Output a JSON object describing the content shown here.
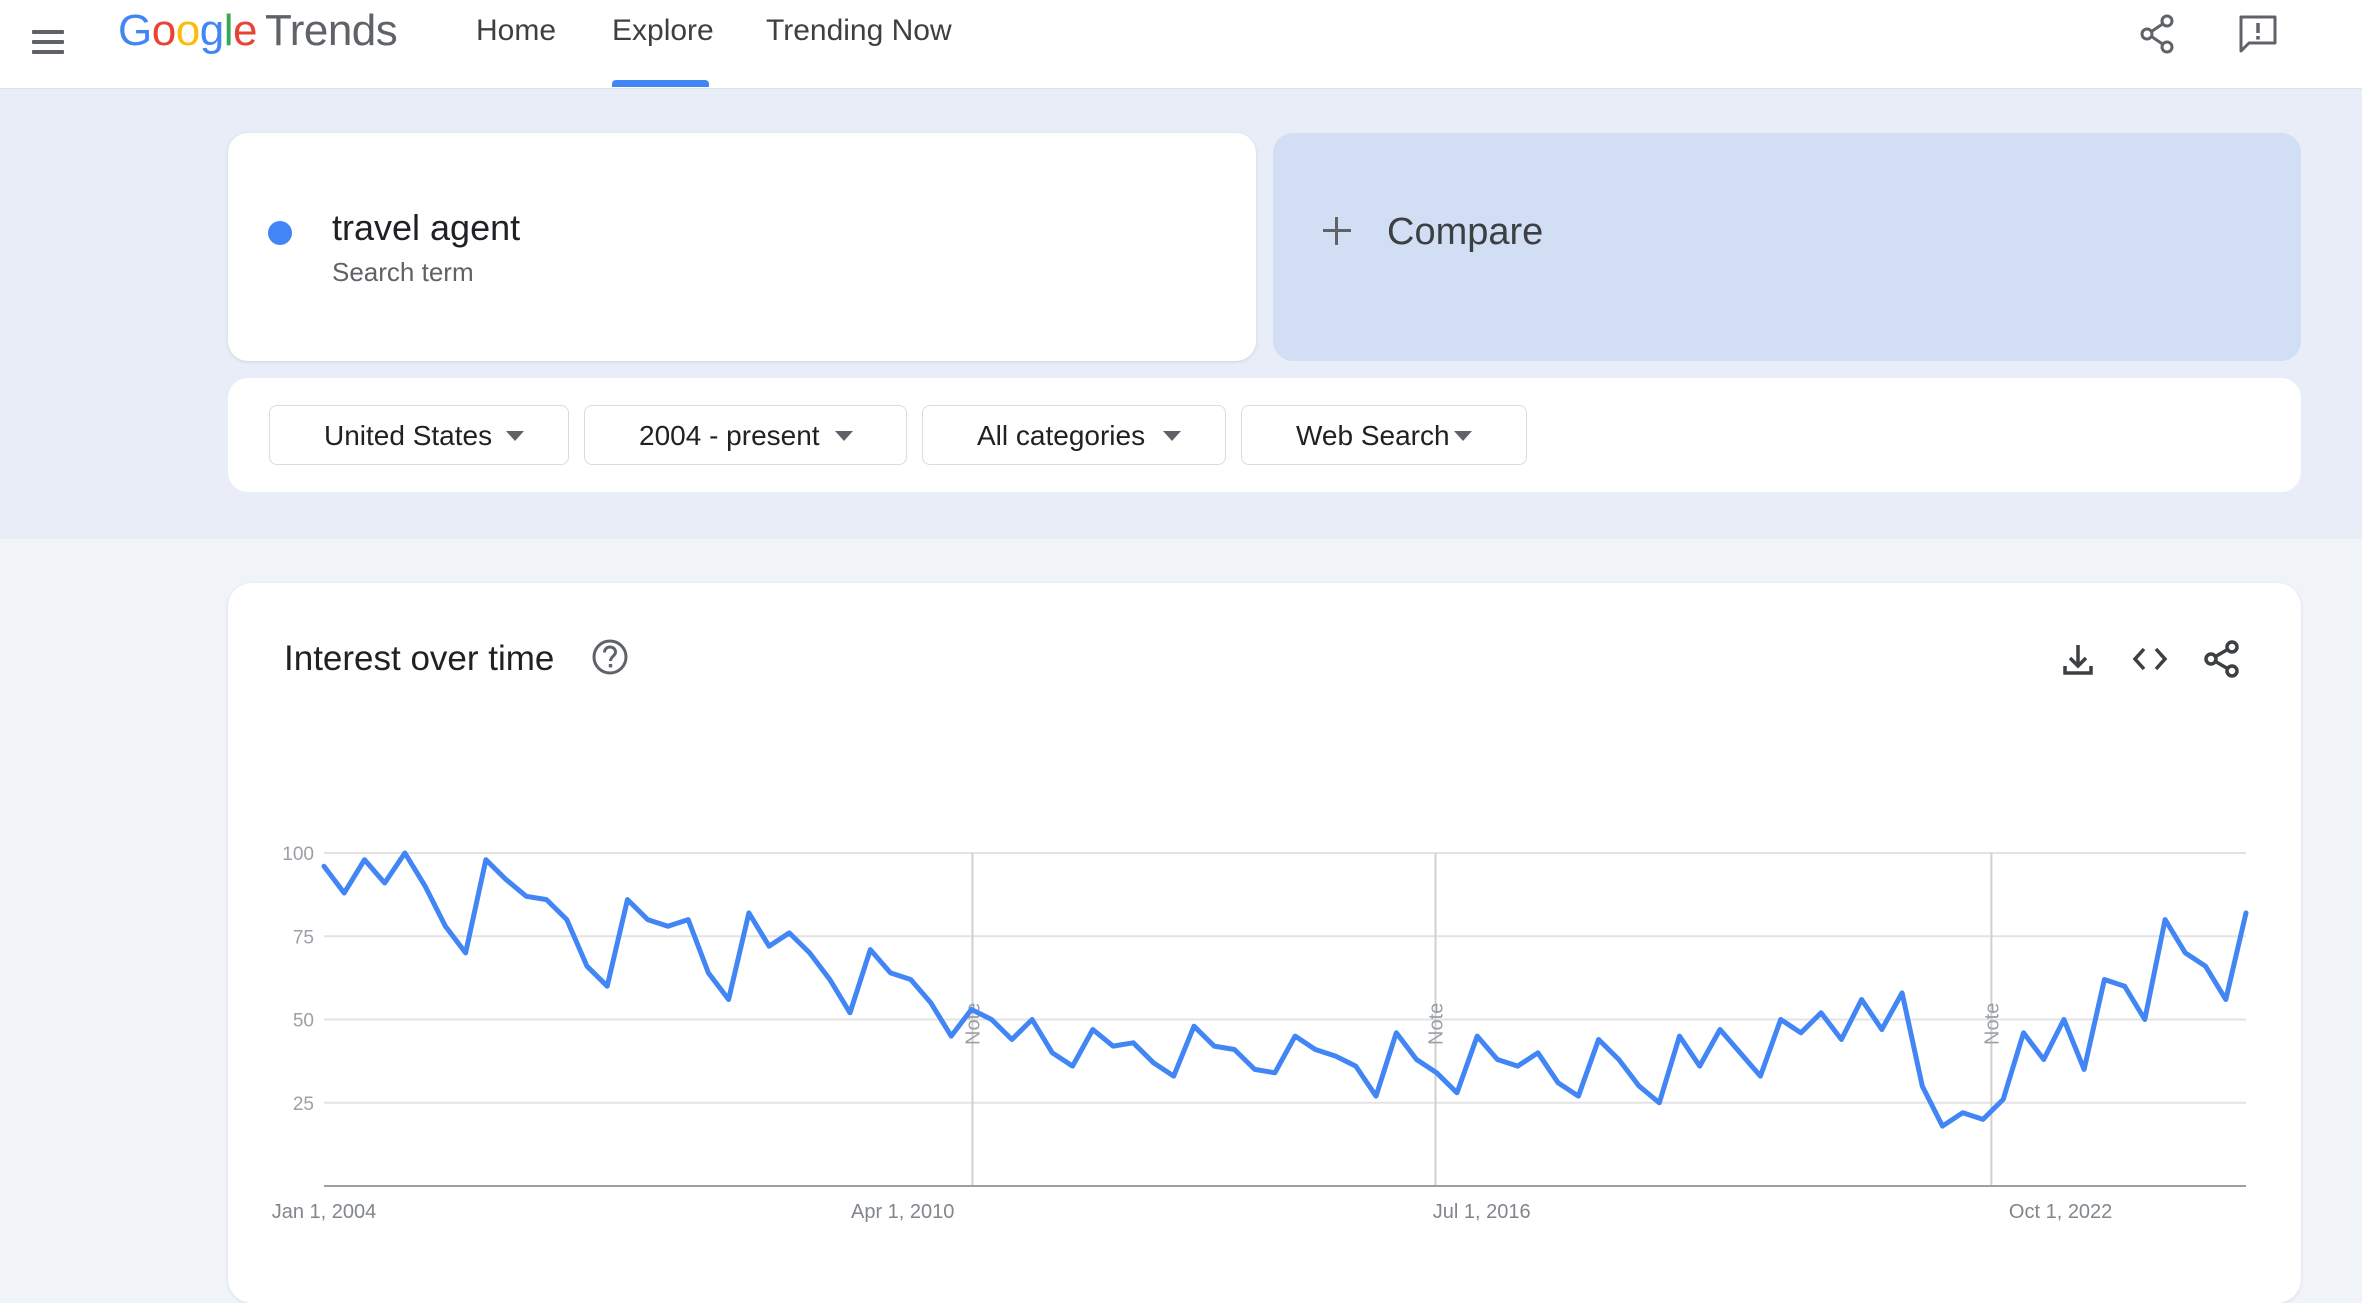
{
  "app": {
    "logo_google": [
      "G",
      "o",
      "o",
      "g",
      "l",
      "e"
    ],
    "logo_trends": "Trends",
    "nav": {
      "home": "Home",
      "explore": "Explore",
      "trending": "Trending Now"
    }
  },
  "search": {
    "term": "travel agent",
    "term_type": "Search term",
    "term_color": "#4285f4",
    "compare_label": "Compare"
  },
  "filters": {
    "region": "United States",
    "time_range": "2004 - present",
    "category": "All categories",
    "property": "Web Search"
  },
  "interest_over_time": {
    "title": "Interest over time"
  },
  "colors": {
    "accent": "#4285f4",
    "compare_bg": "#d2def4",
    "band_bg": "#e8edf7"
  },
  "chart_data": {
    "type": "line",
    "ylim": [
      0,
      100
    ],
    "y_ticks": [
      25,
      50,
      75,
      100
    ],
    "x_range": [
      "2004-01-01",
      "2024-10-01"
    ],
    "x_tick_labels": [
      {
        "date": "2004-01-01",
        "label": "Jan 1, 2004"
      },
      {
        "date": "2010-04-01",
        "label": "Apr 1, 2010"
      },
      {
        "date": "2016-07-01",
        "label": "Jul 1, 2016"
      },
      {
        "date": "2022-10-01",
        "label": "Oct 1, 2022"
      }
    ],
    "notes": [
      {
        "date": "2011-01-01",
        "label": "Note"
      },
      {
        "date": "2016-01-01",
        "label": "Note"
      },
      {
        "date": "2022-01-01",
        "label": "Note"
      }
    ],
    "grid": true,
    "series": [
      {
        "color": "#4285f4",
        "points": [
          [
            "2004-01",
            96
          ],
          [
            "2004-04",
            88
          ],
          [
            "2004-07",
            98
          ],
          [
            "2004-10",
            91
          ],
          [
            "2005-01",
            100
          ],
          [
            "2005-04",
            90
          ],
          [
            "2005-07",
            78
          ],
          [
            "2005-10",
            70
          ],
          [
            "2006-01",
            98
          ],
          [
            "2006-04",
            92
          ],
          [
            "2006-07",
            87
          ],
          [
            "2006-10",
            86
          ],
          [
            "2007-01",
            80
          ],
          [
            "2007-04",
            66
          ],
          [
            "2007-07",
            60
          ],
          [
            "2007-10",
            86
          ],
          [
            "2008-01",
            80
          ],
          [
            "2008-04",
            78
          ],
          [
            "2008-07",
            80
          ],
          [
            "2008-10",
            64
          ],
          [
            "2009-01",
            56
          ],
          [
            "2009-04",
            82
          ],
          [
            "2009-07",
            72
          ],
          [
            "2009-10",
            76
          ],
          [
            "2010-01",
            70
          ],
          [
            "2010-04",
            62
          ],
          [
            "2010-07",
            52
          ],
          [
            "2010-10",
            71
          ],
          [
            "2011-01",
            64
          ],
          [
            "2011-04",
            62
          ],
          [
            "2011-07",
            55
          ],
          [
            "2011-10",
            45
          ],
          [
            "2012-01",
            53
          ],
          [
            "2012-04",
            50
          ],
          [
            "2012-07",
            44
          ],
          [
            "2012-10",
            50
          ],
          [
            "2013-01",
            40
          ],
          [
            "2013-04",
            36
          ],
          [
            "2013-07",
            47
          ],
          [
            "2013-10",
            42
          ],
          [
            "2014-01",
            43
          ],
          [
            "2014-04",
            37
          ],
          [
            "2014-07",
            33
          ],
          [
            "2014-10",
            48
          ],
          [
            "2015-01",
            42
          ],
          [
            "2015-04",
            41
          ],
          [
            "2015-07",
            35
          ],
          [
            "2015-10",
            34
          ],
          [
            "2016-01",
            45
          ],
          [
            "2016-04",
            41
          ],
          [
            "2016-07",
            39
          ],
          [
            "2016-10",
            36
          ],
          [
            "2017-01",
            27
          ],
          [
            "2017-04",
            46
          ],
          [
            "2017-07",
            38
          ],
          [
            "2017-10",
            34
          ],
          [
            "2018-01",
            28
          ],
          [
            "2018-04",
            45
          ],
          [
            "2018-07",
            38
          ],
          [
            "2018-10",
            36
          ],
          [
            "2019-01",
            40
          ],
          [
            "2019-04",
            31
          ],
          [
            "2019-07",
            27
          ],
          [
            "2019-10",
            44
          ],
          [
            "2020-01",
            38
          ],
          [
            "2020-04",
            30
          ],
          [
            "2020-07",
            25
          ],
          [
            "2020-10",
            45
          ],
          [
            "2021-01",
            36
          ],
          [
            "2021-04",
            47
          ],
          [
            "2021-07",
            40
          ],
          [
            "2021-10",
            33
          ],
          [
            "2022-01",
            50
          ],
          [
            "2022-04",
            46
          ],
          [
            "2022-07",
            52
          ],
          [
            "2022-10",
            44
          ],
          [
            "2023-01",
            56
          ],
          [
            "2023-04",
            47
          ],
          [
            "2023-07",
            58
          ],
          [
            "2023-10",
            30
          ],
          [
            "2024-01",
            18
          ],
          [
            "2024-04",
            22
          ],
          [
            "2024-07",
            20
          ],
          [
            "2024-10",
            26
          ],
          [
            "2025-01",
            46
          ],
          [
            "2025-04",
            38
          ],
          [
            "2025-07",
            50
          ],
          [
            "2025-10",
            35
          ],
          [
            "2026-01",
            62
          ],
          [
            "2026-04",
            60
          ],
          [
            "2026-07",
            50
          ],
          [
            "2026-10",
            80
          ],
          [
            "2027-01",
            70
          ],
          [
            "2027-04",
            66
          ],
          [
            "2027-07",
            56
          ],
          [
            "2027-10",
            82
          ]
        ],
        "partial_from_index": null
      }
    ]
  }
}
